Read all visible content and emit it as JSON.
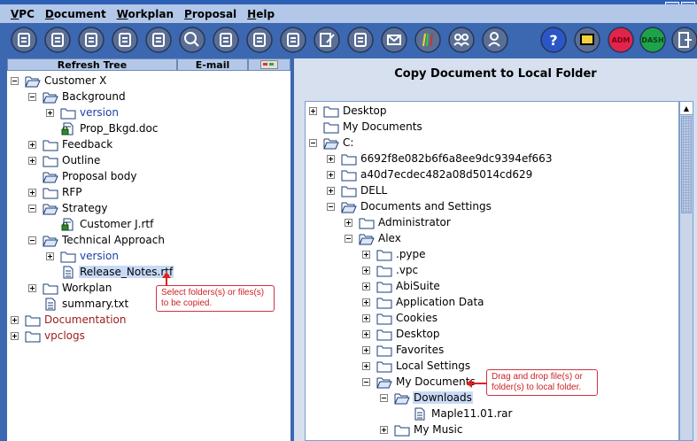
{
  "menu": {
    "items": [
      {
        "underline": "V",
        "rest": "PC"
      },
      {
        "underline": "D",
        "rest": "ocument"
      },
      {
        "underline": "W",
        "rest": "orkplan"
      },
      {
        "underline": "P",
        "rest": "roposal"
      },
      {
        "underline": "H",
        "rest": "elp"
      }
    ]
  },
  "toolbar": {
    "icons": [
      "toolbar-icon-1",
      "toolbar-icon-2",
      "toolbar-icon-3",
      "toolbar-icon-4",
      "toolbar-icon-5",
      "search-icon",
      "toolbar-icon-7",
      "toolbar-icon-8",
      "toolbar-icon-9",
      "edit-icon",
      "toolbar-icon-11",
      "email-icon",
      "colors-icon",
      "people-icon",
      "user-icon",
      "help-icon",
      "toolbar-icon-17",
      "adm-icon",
      "dash-icon",
      "exit-icon"
    ],
    "adm_label": "ADM",
    "dash_label": "DASH",
    "help_label": "?"
  },
  "left_panel": {
    "refresh_label": "Refresh Tree",
    "email_label": "E-mail",
    "tree": [
      {
        "label": "Customer X",
        "icon": "project",
        "exp": "minus",
        "color": "black"
      },
      {
        "label": "Background",
        "icon": "project",
        "exp": "minus",
        "color": "black"
      },
      {
        "label": "version",
        "icon": "folder",
        "exp": "plus",
        "color": "blue"
      },
      {
        "label": "Prop_Bkgd.doc",
        "icon": "doc-locked",
        "exp": "",
        "color": "black"
      },
      {
        "label": "Feedback",
        "icon": "folder",
        "exp": "plus",
        "color": "black"
      },
      {
        "label": "Outline",
        "icon": "folder",
        "exp": "plus",
        "color": "black"
      },
      {
        "label": "Proposal body",
        "icon": "project",
        "exp": "",
        "color": "black"
      },
      {
        "label": "RFP",
        "icon": "folder",
        "exp": "plus",
        "color": "black"
      },
      {
        "label": "Strategy",
        "icon": "project",
        "exp": "minus",
        "color": "black"
      },
      {
        "label": "Customer J.rtf",
        "icon": "doc-locked",
        "exp": "",
        "color": "black"
      },
      {
        "label": "Technical Approach",
        "icon": "project",
        "exp": "minus",
        "color": "black"
      },
      {
        "label": "version",
        "icon": "folder",
        "exp": "plus",
        "color": "blue"
      },
      {
        "label": "Release_Notes.rtf",
        "icon": "doc",
        "exp": "",
        "color": "black",
        "selected": true
      },
      {
        "label": "Workplan",
        "icon": "folder",
        "exp": "plus",
        "color": "black"
      },
      {
        "label": "summary.txt",
        "icon": "doc",
        "exp": "",
        "color": "black"
      },
      {
        "label": "Documentation",
        "icon": "folder",
        "exp": "plus",
        "color": "red"
      },
      {
        "label": "vpclogs",
        "icon": "folder",
        "exp": "plus",
        "color": "red"
      }
    ],
    "callout": "Select folders(s) or files(s) to be copied."
  },
  "right_panel": {
    "title": "Copy Document  to Local Folder",
    "tree": [
      {
        "label": "Desktop",
        "icon": "folder",
        "exp": "plus"
      },
      {
        "label": "My Documents",
        "icon": "folder",
        "exp": ""
      },
      {
        "label": "C:",
        "icon": "open-folder",
        "exp": "minus"
      },
      {
        "label": "6692f8e082b6f6a8ee9dc9394ef663",
        "icon": "folder",
        "exp": "plus"
      },
      {
        "label": "a40d7ecdec482a08d5014cd629",
        "icon": "folder",
        "exp": "plus"
      },
      {
        "label": "DELL",
        "icon": "folder",
        "exp": "plus"
      },
      {
        "label": "Documents and Settings",
        "icon": "open-folder",
        "exp": "minus"
      },
      {
        "label": "Administrator",
        "icon": "folder",
        "exp": "plus"
      },
      {
        "label": "Alex",
        "icon": "open-folder",
        "exp": "minus"
      },
      {
        "label": ".pype",
        "icon": "folder",
        "exp": "plus"
      },
      {
        "label": ".vpc",
        "icon": "folder",
        "exp": "plus"
      },
      {
        "label": "AbiSuite",
        "icon": "folder",
        "exp": "plus"
      },
      {
        "label": "Application Data",
        "icon": "folder",
        "exp": "plus"
      },
      {
        "label": "Cookies",
        "icon": "folder",
        "exp": "plus"
      },
      {
        "label": "Desktop",
        "icon": "folder",
        "exp": "plus"
      },
      {
        "label": "Favorites",
        "icon": "folder",
        "exp": "plus"
      },
      {
        "label": "Local Settings",
        "icon": "folder",
        "exp": "plus"
      },
      {
        "label": "My Documents",
        "icon": "open-folder",
        "exp": "minus"
      },
      {
        "label": "Downloads",
        "icon": "open-folder",
        "exp": "minus",
        "selected": true
      },
      {
        "label": "Maple11.01.rar",
        "icon": "doc",
        "exp": ""
      },
      {
        "label": "My Music",
        "icon": "folder",
        "exp": "plus"
      }
    ],
    "callout": "Drag and drop file(s) or folder(s) to local folder."
  }
}
